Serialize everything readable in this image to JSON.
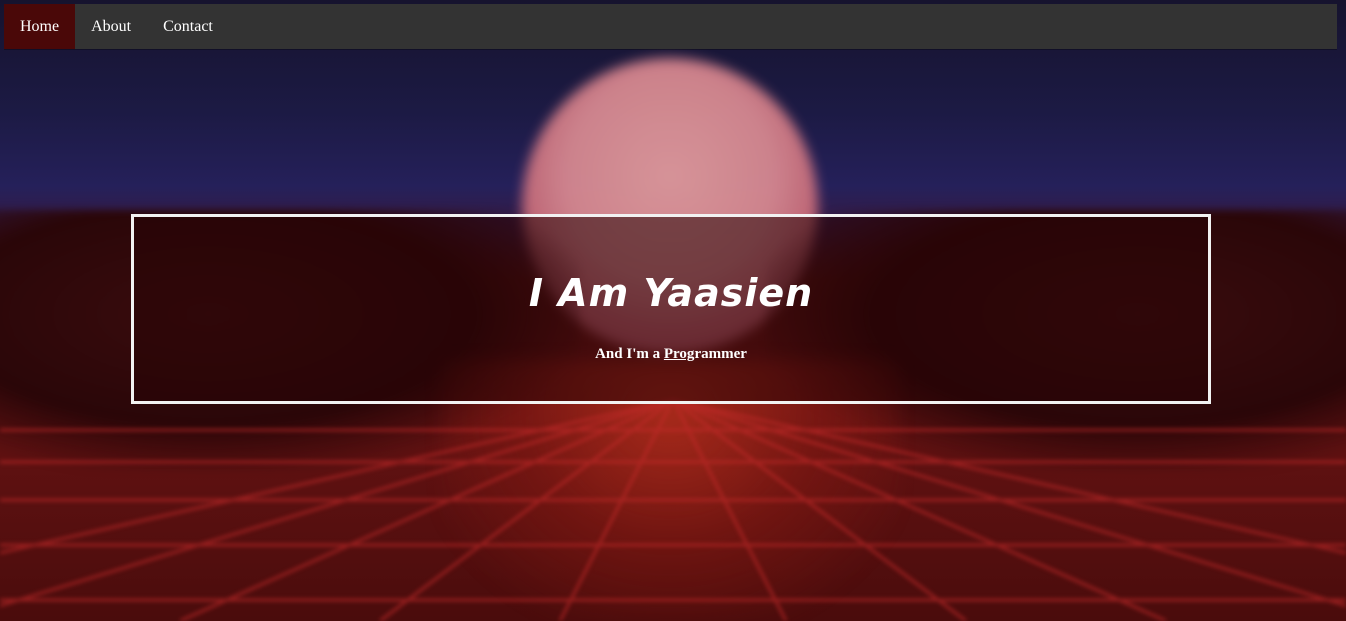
{
  "nav": {
    "items": [
      {
        "label": "Home",
        "active": true
      },
      {
        "label": "About",
        "active": false
      },
      {
        "label": "Contact",
        "active": false
      }
    ]
  },
  "hero": {
    "title": "I Am Yaasien",
    "subtitle_prefix": "And I'm a ",
    "subtitle_typed": "Prog",
    "subtitle_rest": "rammer"
  },
  "colors": {
    "navbar_bg": "#333333",
    "nav_active_bg": "#4a0808",
    "hero_border": "#f2f2f2",
    "text": "#ffffff"
  }
}
